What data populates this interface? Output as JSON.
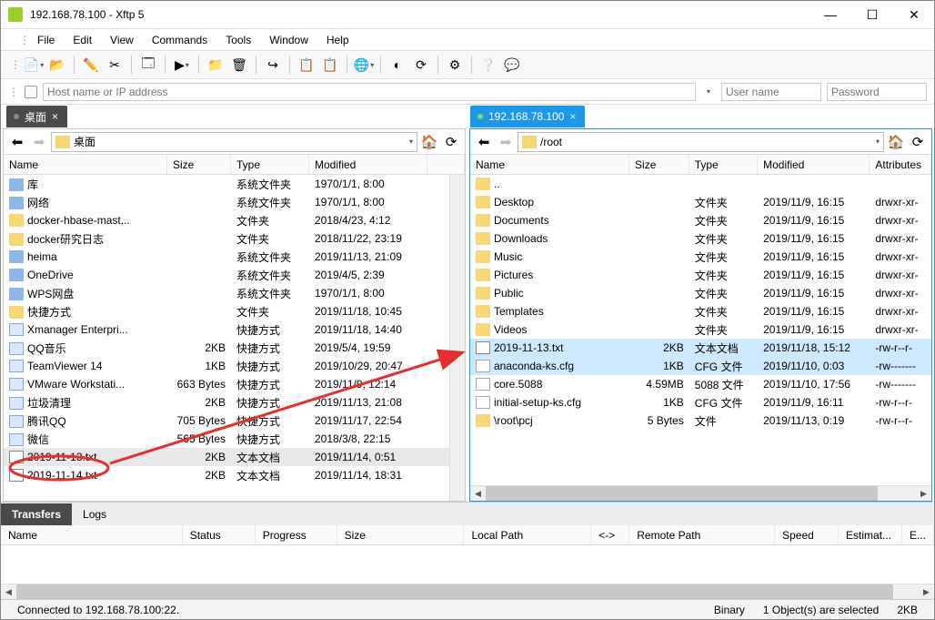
{
  "window": {
    "title": "192.168.78.100     - Xftp 5"
  },
  "menu": {
    "file": "File",
    "edit": "Edit",
    "view": "View",
    "commands": "Commands",
    "tools": "Tools",
    "window": "Window",
    "help": "Help"
  },
  "addr": {
    "placeholder": "Host name or IP address",
    "user_placeholder": "User name",
    "pass_placeholder": "Password"
  },
  "tabs": {
    "local": "桌面",
    "remote": "192.168.78.100"
  },
  "local": {
    "path": "桌面",
    "cols": {
      "name": "Name",
      "size": "Size",
      "type": "Type",
      "modified": "Modified"
    },
    "rows": [
      {
        "icon": "sys",
        "name": "库",
        "size": "",
        "type": "系统文件夹",
        "modified": "1970/1/1, 8:00"
      },
      {
        "icon": "sys",
        "name": "网络",
        "size": "",
        "type": "系统文件夹",
        "modified": "1970/1/1, 8:00"
      },
      {
        "icon": "folder",
        "name": "docker-hbase-mast...",
        "size": "",
        "type": "文件夹",
        "modified": "2018/4/23, 4:12"
      },
      {
        "icon": "folder",
        "name": "docker研究日志",
        "size": "",
        "type": "文件夹",
        "modified": "2018/11/22, 23:19"
      },
      {
        "icon": "sys",
        "name": "heima",
        "size": "",
        "type": "系统文件夹",
        "modified": "2019/11/13, 21:09"
      },
      {
        "icon": "sys",
        "name": "OneDrive",
        "size": "",
        "type": "系统文件夹",
        "modified": "2019/4/5, 2:39"
      },
      {
        "icon": "sys",
        "name": "WPS网盘",
        "size": "",
        "type": "系统文件夹",
        "modified": "1970/1/1, 8:00"
      },
      {
        "icon": "folder",
        "name": "快捷方式",
        "size": "",
        "type": "文件夹",
        "modified": "2019/11/18, 10:45"
      },
      {
        "icon": "link",
        "name": "Xmanager Enterpri...",
        "size": "",
        "type": "快捷方式",
        "modified": "2019/11/18, 14:40"
      },
      {
        "icon": "link",
        "name": "QQ音乐",
        "size": "2KB",
        "type": "快捷方式",
        "modified": "2019/5/4, 19:59"
      },
      {
        "icon": "link",
        "name": "TeamViewer 14",
        "size": "1KB",
        "type": "快捷方式",
        "modified": "2019/10/29, 20:47"
      },
      {
        "icon": "link",
        "name": "VMware Workstati...",
        "size": "663 Bytes",
        "type": "快捷方式",
        "modified": "2019/11/9, 12:14"
      },
      {
        "icon": "link",
        "name": "垃圾清理",
        "size": "2KB",
        "type": "快捷方式",
        "modified": "2019/11/13, 21:08"
      },
      {
        "icon": "link",
        "name": "腾讯QQ",
        "size": "705 Bytes",
        "type": "快捷方式",
        "modified": "2019/11/17, 22:54"
      },
      {
        "icon": "link",
        "name": "微信",
        "size": "565 Bytes",
        "type": "快捷方式",
        "modified": "2018/3/8, 22:15"
      },
      {
        "icon": "txt",
        "name": "2019-11-13.txt",
        "size": "2KB",
        "type": "文本文档",
        "modified": "2019/11/14, 0:51",
        "circled": true
      },
      {
        "icon": "txt",
        "name": "2019-11-14.txt",
        "size": "2KB",
        "type": "文本文档",
        "modified": "2019/11/14, 18:31"
      }
    ]
  },
  "remote": {
    "path": "/root",
    "cols": {
      "name": "Name",
      "size": "Size",
      "type": "Type",
      "modified": "Modified",
      "attr": "Attributes"
    },
    "rows": [
      {
        "icon": "folder",
        "name": "..",
        "size": "",
        "type": "",
        "modified": "",
        "attr": ""
      },
      {
        "icon": "folder",
        "name": "Desktop",
        "size": "",
        "type": "文件夹",
        "modified": "2019/11/9, 16:15",
        "attr": "drwxr-xr-"
      },
      {
        "icon": "folder",
        "name": "Documents",
        "size": "",
        "type": "文件夹",
        "modified": "2019/11/9, 16:15",
        "attr": "drwxr-xr-"
      },
      {
        "icon": "folder",
        "name": "Downloads",
        "size": "",
        "type": "文件夹",
        "modified": "2019/11/9, 16:15",
        "attr": "drwxr-xr-"
      },
      {
        "icon": "folder",
        "name": "Music",
        "size": "",
        "type": "文件夹",
        "modified": "2019/11/9, 16:15",
        "attr": "drwxr-xr-"
      },
      {
        "icon": "folder",
        "name": "Pictures",
        "size": "",
        "type": "文件夹",
        "modified": "2019/11/9, 16:15",
        "attr": "drwxr-xr-"
      },
      {
        "icon": "folder",
        "name": "Public",
        "size": "",
        "type": "文件夹",
        "modified": "2019/11/9, 16:15",
        "attr": "drwxr-xr-"
      },
      {
        "icon": "folder",
        "name": "Templates",
        "size": "",
        "type": "文件夹",
        "modified": "2019/11/9, 16:15",
        "attr": "drwxr-xr-"
      },
      {
        "icon": "folder",
        "name": "Videos",
        "size": "",
        "type": "文件夹",
        "modified": "2019/11/9, 16:15",
        "attr": "drwxr-xr-"
      },
      {
        "icon": "txt",
        "name": "2019-11-13.txt",
        "size": "2KB",
        "type": "文本文档",
        "modified": "2019/11/18, 15:12",
        "attr": "-rw-r--r-",
        "sel": true
      },
      {
        "icon": "file",
        "name": "anaconda-ks.cfg",
        "size": "1KB",
        "type": "CFG 文件",
        "modified": "2019/11/10, 0:03",
        "attr": "-rw-------",
        "sel": true
      },
      {
        "icon": "file",
        "name": "core.5088",
        "size": "4.59MB",
        "type": "5088 文件",
        "modified": "2019/11/10, 17:56",
        "attr": "-rw-------"
      },
      {
        "icon": "file",
        "name": "initial-setup-ks.cfg",
        "size": "1KB",
        "type": "CFG 文件",
        "modified": "2019/11/9, 16:11",
        "attr": "-rw-r--r-"
      },
      {
        "icon": "folder",
        "name": "\\root\\pcj",
        "size": "5 Bytes",
        "type": "文件",
        "modified": "2019/11/13, 0:19",
        "attr": "-rw-r--r-"
      }
    ]
  },
  "transfers": {
    "tab1": "Transfers",
    "tab2": "Logs",
    "cols": {
      "name": "Name",
      "status": "Status",
      "progress": "Progress",
      "size": "Size",
      "localpath": "Local Path",
      "arrow": "<->",
      "remotepath": "Remote Path",
      "speed": "Speed",
      "estimate": "Estimat...",
      "elapsed": "E..."
    }
  },
  "status": {
    "conn": "Connected to 192.168.78.100:22.",
    "mode": "Binary",
    "sel": "1 Object(s) are selected",
    "total": "2KB"
  }
}
